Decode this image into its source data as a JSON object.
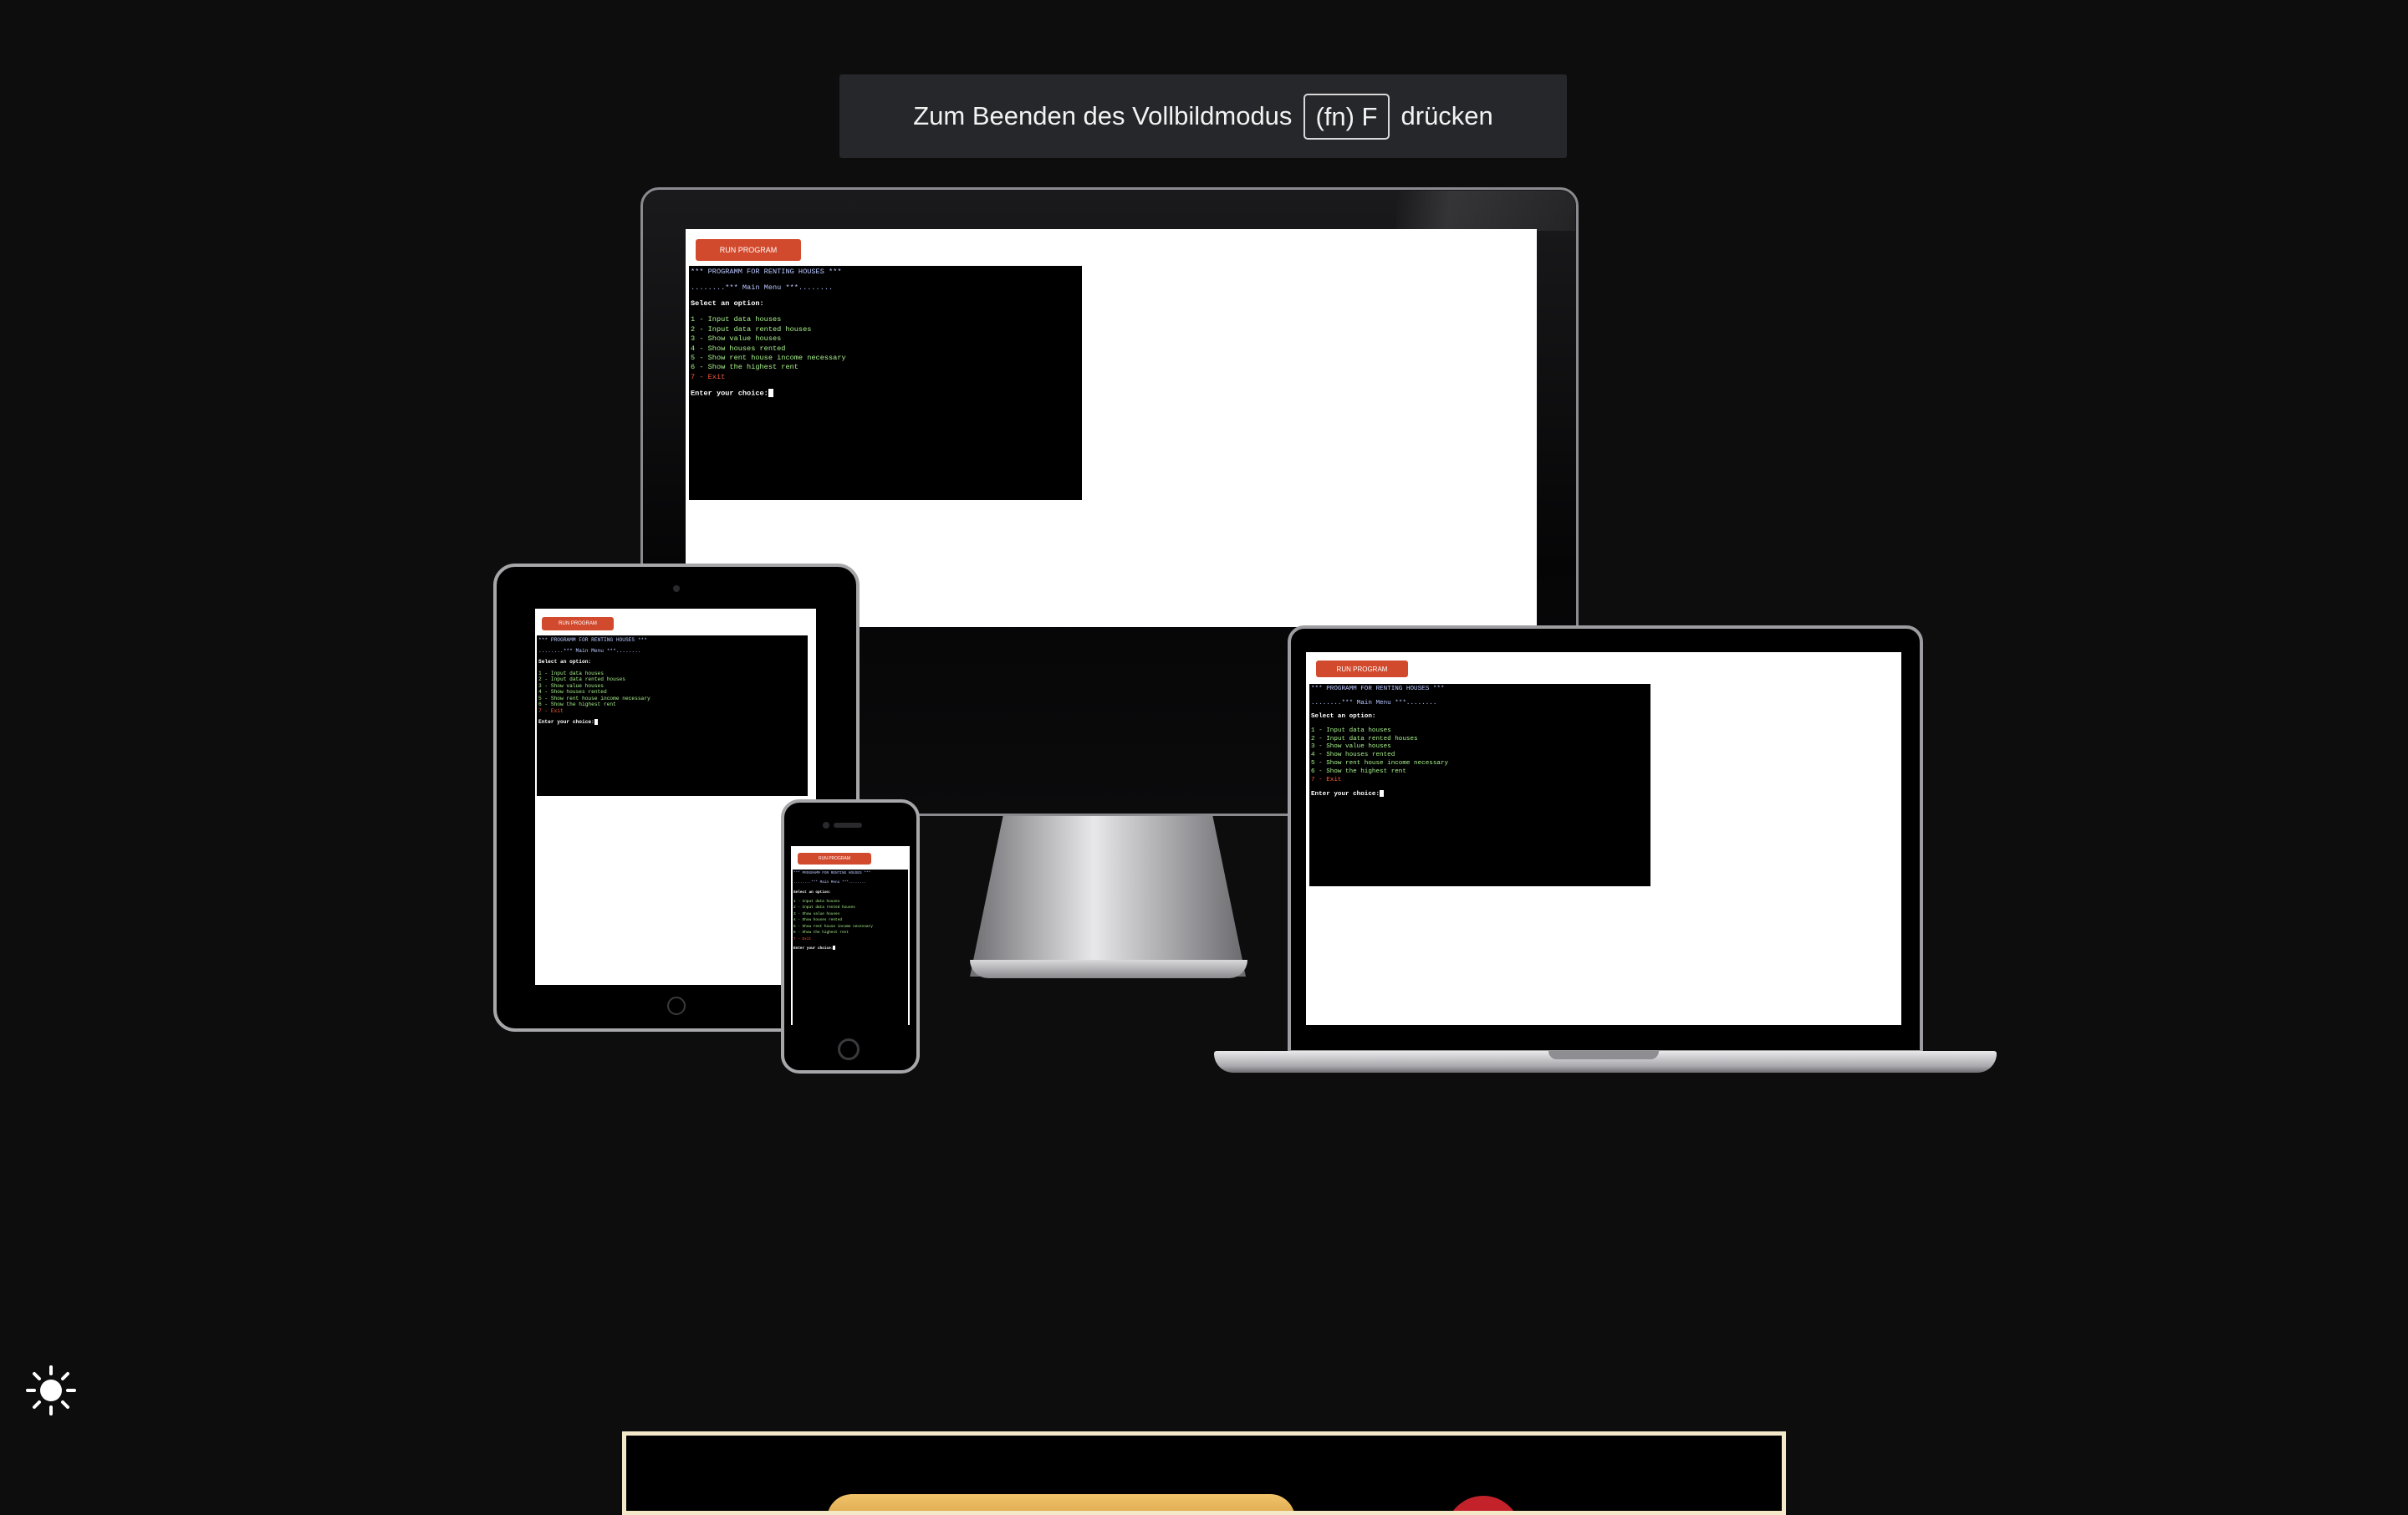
{
  "fullscreen_notice": {
    "before": "Zum Beenden des Vollbildmodus",
    "key": "(fn) F",
    "after": "drücken"
  },
  "app": {
    "run_button": "RUN PROGRAM",
    "terminal": {
      "title": "*** PROGRAMM FOR RENTING HOUSES ***",
      "menu": "........*** Main Menu ***........",
      "prompt_select": "Select an option:",
      "options": [
        "1 - Input data houses",
        "2 - Input data rented houses",
        "3 - Show value houses",
        "4 - Show houses rented",
        "5 - Show rent house income necessary",
        "6 - Show the highest rent"
      ],
      "exit_option": "7 - Exit",
      "input_prompt": "Enter your choice:"
    }
  },
  "colors": {
    "page_background": "#0d0d0e",
    "run_button": "#d24a2d",
    "terminal_bg": "#000000",
    "option_text": "#a6f08a",
    "exit_text": "#ff5a3c",
    "title_text": "#b9c7ff"
  },
  "theme_toggle": {
    "icon": "sun-icon"
  }
}
